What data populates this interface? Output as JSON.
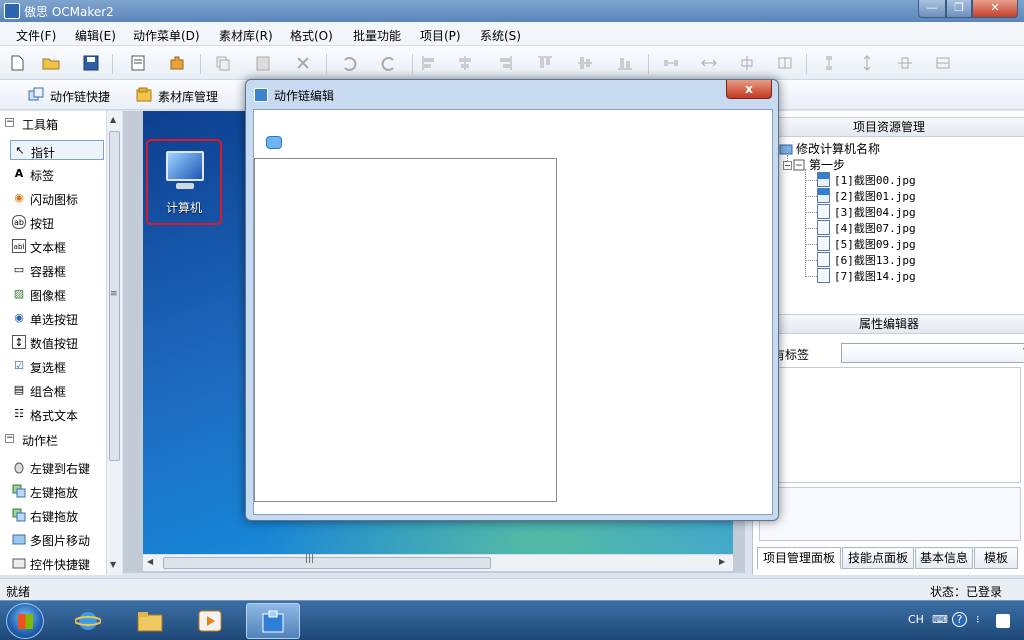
{
  "window": {
    "title": "傲思 OCMaker2",
    "min": "—",
    "max": "❐",
    "close": "✕"
  },
  "menu": [
    "文件(F)",
    "编辑(E)",
    "动作菜单(D)",
    "素材库(R)",
    "格式(O)",
    "批量功能",
    "项目(P)",
    "系统(S)"
  ],
  "quickbar": {
    "action_chain": "动作链快捷",
    "material_lib": "素材库管理"
  },
  "toolbox": {
    "title": "工具箱",
    "items": [
      "指针",
      "标签",
      "闪动图标",
      "按钮",
      "文本框",
      "容器框",
      "图像框",
      "单选按钮",
      "数值按钮",
      "复选框",
      "组合框",
      "格式文本"
    ],
    "icons": [
      "↖",
      "A",
      "◉",
      "ab",
      "abl",
      "▭",
      "▨",
      "◉",
      "↕",
      "☑",
      "▤",
      "☷"
    ],
    "action_title": "动作栏",
    "actions": [
      "左键到右键",
      "左键拖放",
      "右键拖放",
      "多图片移动",
      "控件快捷键"
    ]
  },
  "canvas": {
    "computer_label": "计算机"
  },
  "dialog": {
    "title": "动作链编辑",
    "close": "x"
  },
  "project_panel": {
    "title": "项目资源管理",
    "root": "修改计算机名称",
    "step": "第一步",
    "files": [
      "[1]截图00.jpg",
      "[2]截图01.jpg",
      "[3]截图04.jpg",
      "[4]截图07.jpg",
      "[5]截图09.jpg",
      "[6]截图13.jpg",
      "[7]截图14.jpg"
    ]
  },
  "property_panel": {
    "title": "属性编辑器",
    "row_label": "有标签",
    "select_value": ""
  },
  "right_tabs": [
    "项目管理面板",
    "技能点面板",
    "基本信息",
    "模板"
  ],
  "status": {
    "left": "就绪",
    "right": "状态：已登录"
  },
  "taskbar": {
    "ime": "CH"
  },
  "colors": {
    "accent": "#2d66b0",
    "highlight_border": "#e0162b",
    "close_button": "#c5402a"
  }
}
